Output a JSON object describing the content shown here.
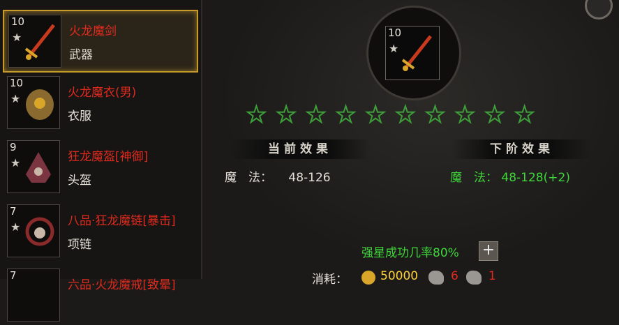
{
  "items": [
    {
      "level": "10",
      "name": "火龙魔剑",
      "type": "武器"
    },
    {
      "level": "10",
      "name": "火龙魔衣(男)",
      "type": "衣服"
    },
    {
      "level": "9",
      "name": "狂龙魔盔[神御]",
      "type": "头盔"
    },
    {
      "level": "7",
      "name": "八品·狂龙魔链[暴击]",
      "type": "项链"
    },
    {
      "level": "7",
      "name": "六品·火龙魔戒[致晕]",
      "type": ""
    }
  ],
  "selected": {
    "level": "10"
  },
  "stars": {
    "total": 10,
    "filled": 0
  },
  "current": {
    "title": "当前效果",
    "stat": "魔　法：",
    "value": "48-126"
  },
  "next": {
    "title": "下阶效果",
    "stat": "魔　法：",
    "value": "48-128(+2)"
  },
  "success_rate": "强星成功几率80%",
  "cost": {
    "label": "消耗：",
    "gold": "50000",
    "ore1": "6",
    "ore2": "1"
  },
  "colors": {
    "accent": "#c89a2a",
    "green": "#3fd63a",
    "red": "#e02a1e"
  }
}
